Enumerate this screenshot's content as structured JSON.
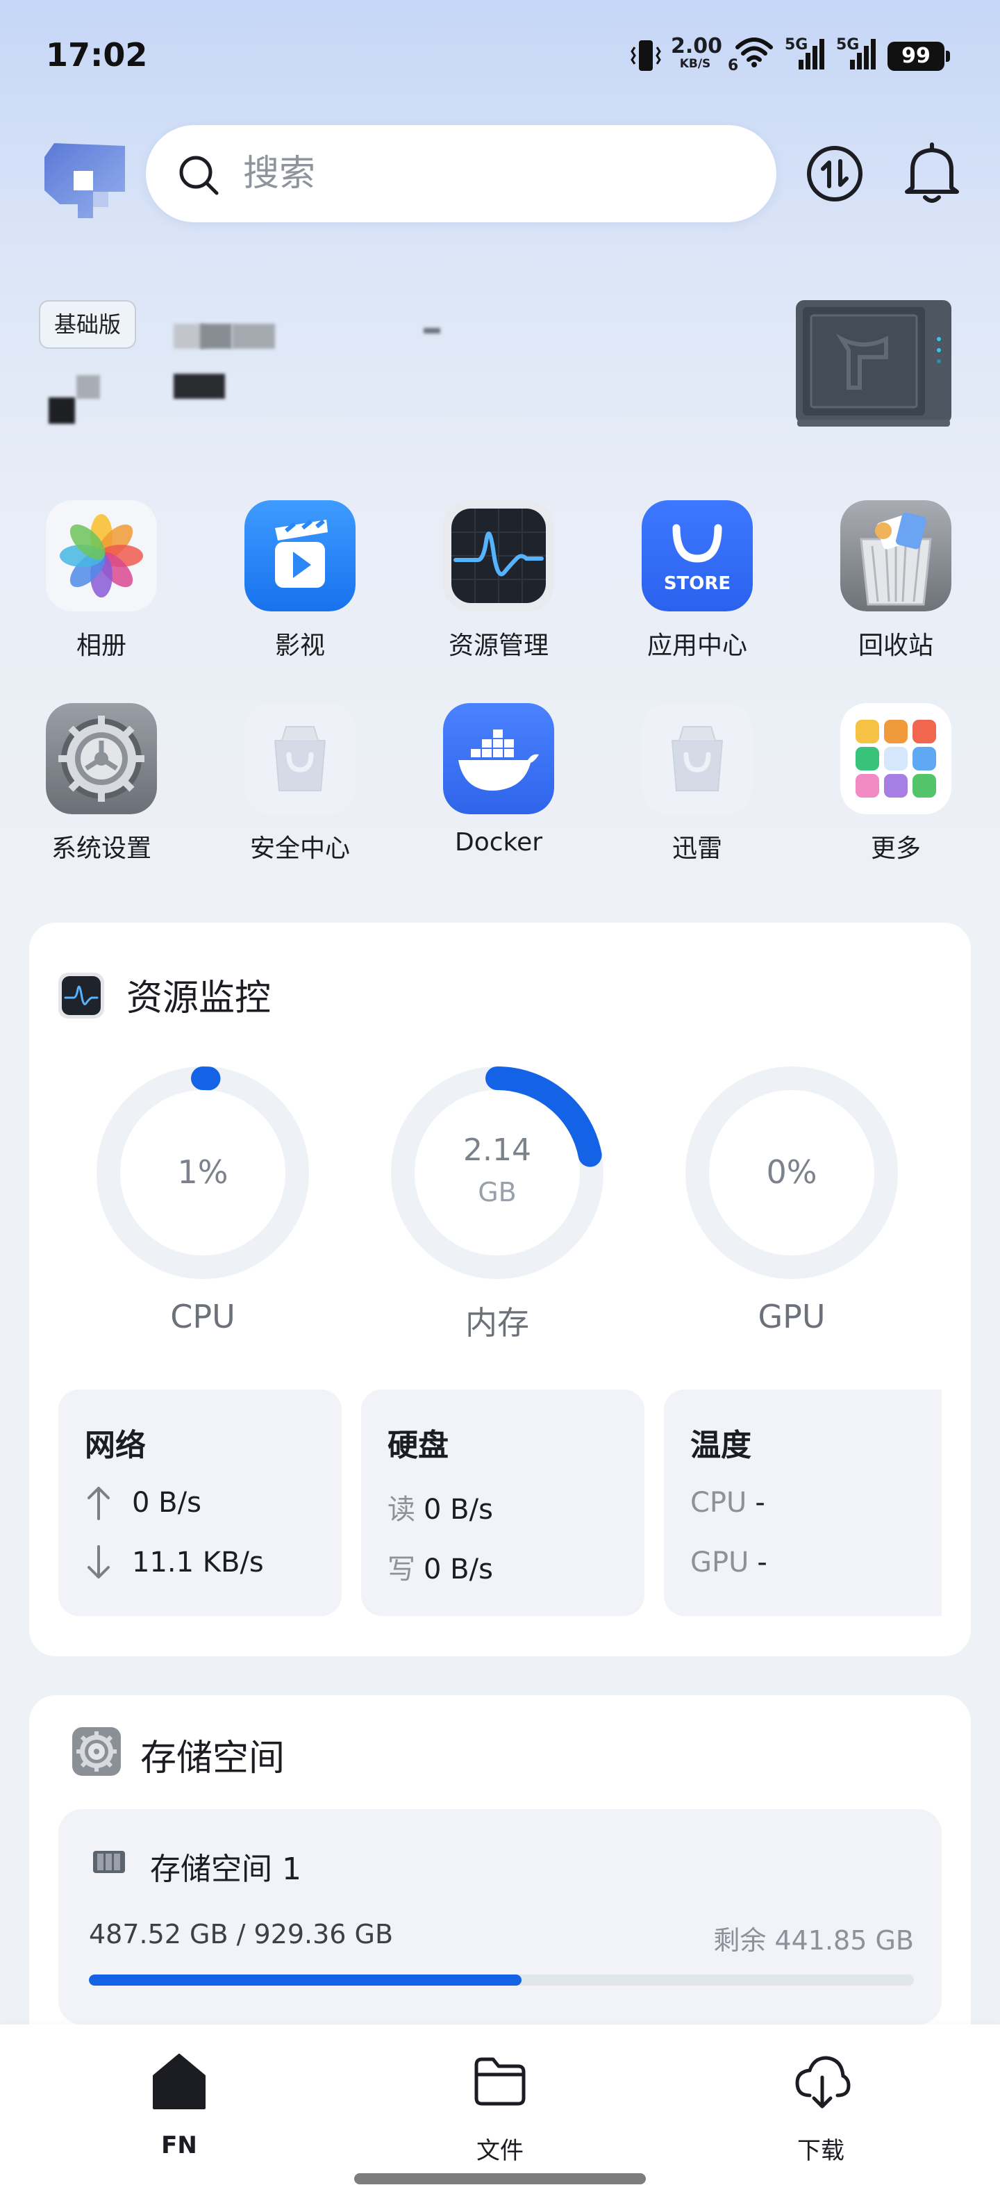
{
  "status_bar": {
    "time": "17:02",
    "net_speed_value": "2.00",
    "net_speed_unit": "KB/S",
    "wifi_sub": "6",
    "sim1_label": "5G",
    "sim2_label": "5G",
    "battery": "99",
    "icons": [
      "vibrate-icon",
      "wifi-icon",
      "signal-icon",
      "signal-icon",
      "battery-icon"
    ]
  },
  "header": {
    "search_placeholder": "搜索",
    "icons": [
      "app-logo",
      "search-icon",
      "transfer-icon",
      "bell-icon"
    ]
  },
  "device": {
    "plan_badge": "基础版"
  },
  "apps": [
    {
      "label": "相册",
      "icon": "photos-icon"
    },
    {
      "label": "影视",
      "icon": "video-icon"
    },
    {
      "label": "资源管理",
      "icon": "activity-monitor-icon"
    },
    {
      "label": "应用中心",
      "icon": "store-icon"
    },
    {
      "label": "回收站",
      "icon": "trash-icon"
    },
    {
      "label": "系统设置",
      "icon": "settings-gear-icon"
    },
    {
      "label": "安全中心",
      "icon": "shopping-bag-icon"
    },
    {
      "label": "Docker",
      "icon": "docker-icon"
    },
    {
      "label": "迅雷",
      "icon": "shopping-bag-icon"
    },
    {
      "label": "更多",
      "icon": "app-grid-icon"
    }
  ],
  "store_icon_text": "STORE",
  "resource_monitor": {
    "title": "资源监控",
    "gauges": [
      {
        "label": "CPU",
        "value": "1%",
        "unit": "",
        "fraction": 0.01
      },
      {
        "label": "内存",
        "value": "2.14",
        "unit": "GB",
        "fraction": 0.22
      },
      {
        "label": "GPU",
        "value": "0%",
        "unit": "",
        "fraction": 0
      }
    ],
    "network": {
      "title": "网络",
      "up": "0 B/s",
      "down": "11.1 KB/s"
    },
    "disk": {
      "title": "硬盘",
      "read_label": "读",
      "read": "0 B/s",
      "write_label": "写",
      "write": "0 B/s"
    },
    "temperature": {
      "title": "温度",
      "cpu_label": "CPU",
      "cpu": "-",
      "gpu_label": "GPU",
      "gpu": "-"
    }
  },
  "storage": {
    "title": "存储空间",
    "pools": [
      {
        "name": "存储空间 1",
        "used_total": "487.52 GB / 929.36 GB",
        "free": "剩余 441.85 GB",
        "used_fraction": 0.5246
      }
    ]
  },
  "bottom_nav": [
    {
      "label": "FN",
      "icon": "home-icon",
      "active": true
    },
    {
      "label": "文件",
      "icon": "folder-icon",
      "active": false
    },
    {
      "label": "下载",
      "icon": "download-icon",
      "active": false
    }
  ],
  "colors": {
    "accent": "#1463e6",
    "ring_track": "#eef1f6",
    "text": "#1c1d22",
    "muted": "#8c919a"
  }
}
